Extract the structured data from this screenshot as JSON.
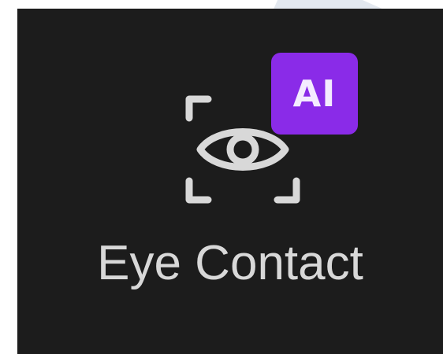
{
  "feature": {
    "label": "Eye Contact",
    "badge": "AI",
    "icon": "eye-focus-icon"
  },
  "colors": {
    "tile_background": "#1c1c1c",
    "badge_background": "#8a2be8",
    "badge_text": "#f4ecff",
    "label_text": "#d8d8d8",
    "icon_stroke": "#d8d8d8"
  }
}
